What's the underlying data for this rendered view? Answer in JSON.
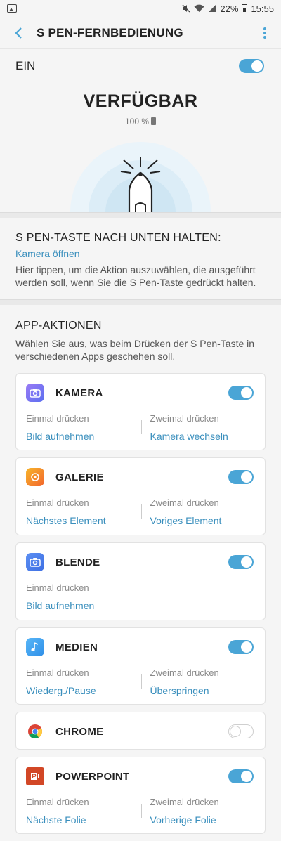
{
  "status_bar": {
    "battery_text": "22%",
    "time": "15:55"
  },
  "app_bar": {
    "title": "S PEN-FERNBEDIENUNG"
  },
  "master_switch": {
    "label": "EIN",
    "on": true
  },
  "status": {
    "title": "VERFÜGBAR",
    "battery": "100 %"
  },
  "hold_button": {
    "title": "S PEN-TASTE NACH UNTEN HALTEN:",
    "action": "Kamera öffnen",
    "description": "Hier tippen, um die Aktion auszuwählen, die ausgeführt werden soll, wenn Sie die S Pen-Taste gedrückt halten."
  },
  "app_actions": {
    "title": "APP-AKTIONEN",
    "description": "Wählen Sie aus, was beim Drücken der S Pen-Taste in verschiedenen Apps geschehen soll.",
    "apps": [
      {
        "name": "KAMERA",
        "on": true,
        "icon": "camera-icon",
        "once_label": "Einmal drücken",
        "once_value": "Bild aufnehmen",
        "twice_label": "Zweimal drücken",
        "twice_value": "Kamera wechseln"
      },
      {
        "name": "GALERIE",
        "on": true,
        "icon": "gallery-icon",
        "once_label": "Einmal drücken",
        "once_value": "Nächstes Element",
        "twice_label": "Zweimal drücken",
        "twice_value": "Voriges Element"
      },
      {
        "name": "BLENDE",
        "on": true,
        "icon": "camera-icon",
        "once_label": "Einmal drücken",
        "once_value": "Bild aufnehmen"
      },
      {
        "name": "MEDIEN",
        "on": true,
        "icon": "music-note-icon",
        "once_label": "Einmal drücken",
        "once_value": "Wiederg./Pause",
        "twice_label": "Zweimal drücken",
        "twice_value": "Überspringen"
      },
      {
        "name": "CHROME",
        "on": false,
        "icon": "chrome-icon"
      },
      {
        "name": "POWERPOINT",
        "on": true,
        "icon": "powerpoint-icon",
        "once_label": "Einmal drücken",
        "once_value": "Nächste Folie",
        "twice_label": "Zweimal drücken",
        "twice_value": "Vorherige Folie"
      }
    ]
  },
  "colors": {
    "accent": "#4aa5d6",
    "link": "#3a8fbd"
  }
}
